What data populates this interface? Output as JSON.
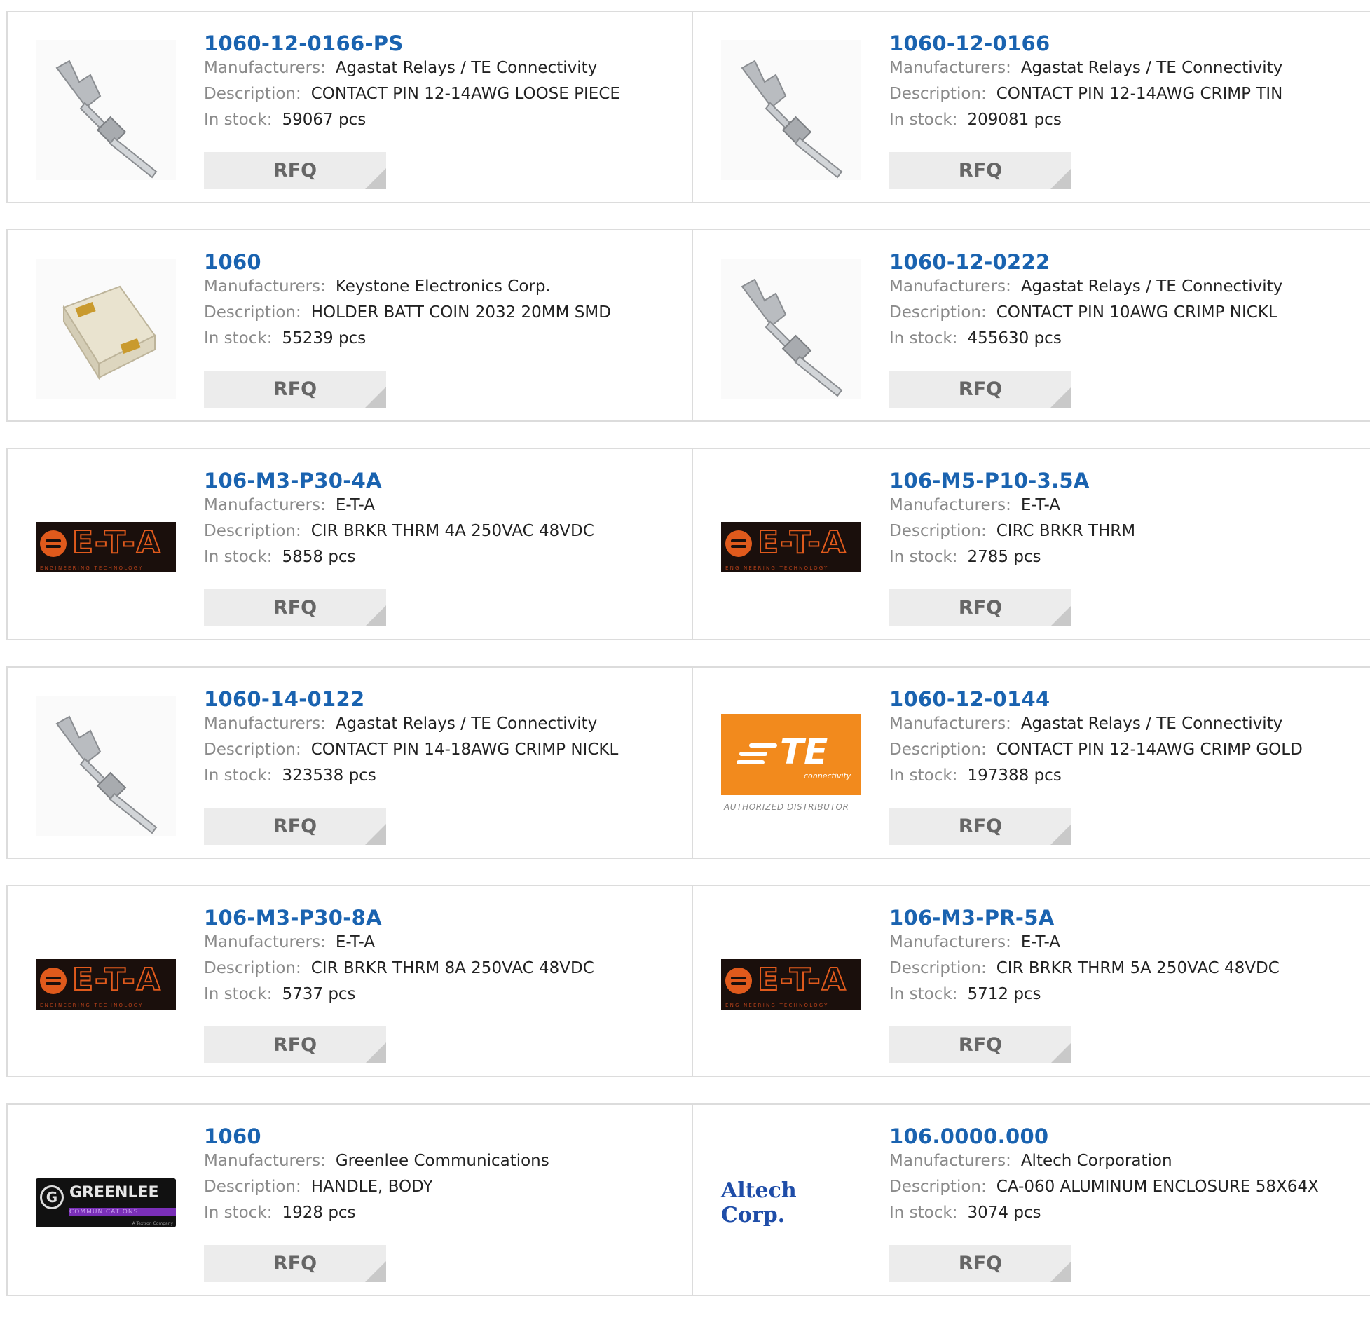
{
  "labels": {
    "manufacturers": "Manufacturers:",
    "description": "Description:",
    "in_stock": "In stock:",
    "rfq": "RFQ"
  },
  "products": [
    {
      "part": "1060-12-0166-PS",
      "manufacturer": "Agastat Relays / TE Connectivity",
      "description": "CONTACT PIN 12-14AWG LOOSE PIECE",
      "stock": "59067 pcs",
      "image": "contact-pin-icon"
    },
    {
      "part": "1060-12-0166",
      "manufacturer": "Agastat Relays / TE Connectivity",
      "description": "CONTACT PIN 12-14AWG CRIMP TIN",
      "stock": "209081 pcs",
      "image": "contact-pin-icon"
    },
    {
      "part": "1060",
      "manufacturer": "Keystone Electronics Corp.",
      "description": "HOLDER BATT COIN 2032 20MM SMD",
      "stock": "55239 pcs",
      "image": "battery-holder-icon"
    },
    {
      "part": "1060-12-0222",
      "manufacturer": "Agastat Relays / TE Connectivity",
      "description": "CONTACT PIN 10AWG CRIMP NICKL",
      "stock": "455630 pcs",
      "image": "contact-pin-icon"
    },
    {
      "part": "106-M3-P30-4A",
      "manufacturer": "E-T-A",
      "description": "CIR BRKR THRM 4A 250VAC 48VDC",
      "stock": "5858 pcs",
      "image": "eta-logo"
    },
    {
      "part": "106-M5-P10-3.5A",
      "manufacturer": "E-T-A",
      "description": "CIRC BRKR THRM",
      "stock": "2785 pcs",
      "image": "eta-logo"
    },
    {
      "part": "1060-14-0122",
      "manufacturer": "Agastat Relays / TE Connectivity",
      "description": "CONTACT PIN 14-18AWG CRIMP NICKL",
      "stock": "323538 pcs",
      "image": "contact-pin-icon"
    },
    {
      "part": "1060-12-0144",
      "manufacturer": "Agastat Relays / TE Connectivity",
      "description": "CONTACT PIN 12-14AWG CRIMP GOLD",
      "stock": "197388 pcs",
      "image": "te-logo"
    },
    {
      "part": "106-M3-P30-8A",
      "manufacturer": "E-T-A",
      "description": "CIR BRKR THRM 8A 250VAC 48VDC",
      "stock": "5737 pcs",
      "image": "eta-logo"
    },
    {
      "part": "106-M3-PR-5A",
      "manufacturer": "E-T-A",
      "description": "CIR BRKR THRM 5A 250VAC 48VDC",
      "stock": "5712 pcs",
      "image": "eta-logo"
    },
    {
      "part": "1060",
      "manufacturer": "Greenlee Communications",
      "description": "HANDLE, BODY",
      "stock": "1928 pcs",
      "image": "greenlee-logo"
    },
    {
      "part": "106.0000.000",
      "manufacturer": "Altech Corporation",
      "description": "CA-060 ALUMINUM ENCLOSURE 58X64X",
      "stock": "3074 pcs",
      "image": "altech-logo"
    }
  ],
  "logos": {
    "eta_text": "E-T-A",
    "eta_sub": "ENGINEERING TECHNOLOGY",
    "te_text": "TE",
    "te_sub": "connectivity",
    "te_auth": "AUTHORIZED DISTRIBUTOR",
    "greenlee_name": "GREENLEE",
    "greenlee_comm": "COMMUNICATIONS",
    "greenlee_tex": "A Textron Company",
    "greenlee_g": "G",
    "altech_text": "Altech Corp."
  },
  "colors": {
    "link": "#1a63b0",
    "label": "#8a8a8a",
    "rfq_bg": "#ececec",
    "border": "#dcdcdc"
  }
}
